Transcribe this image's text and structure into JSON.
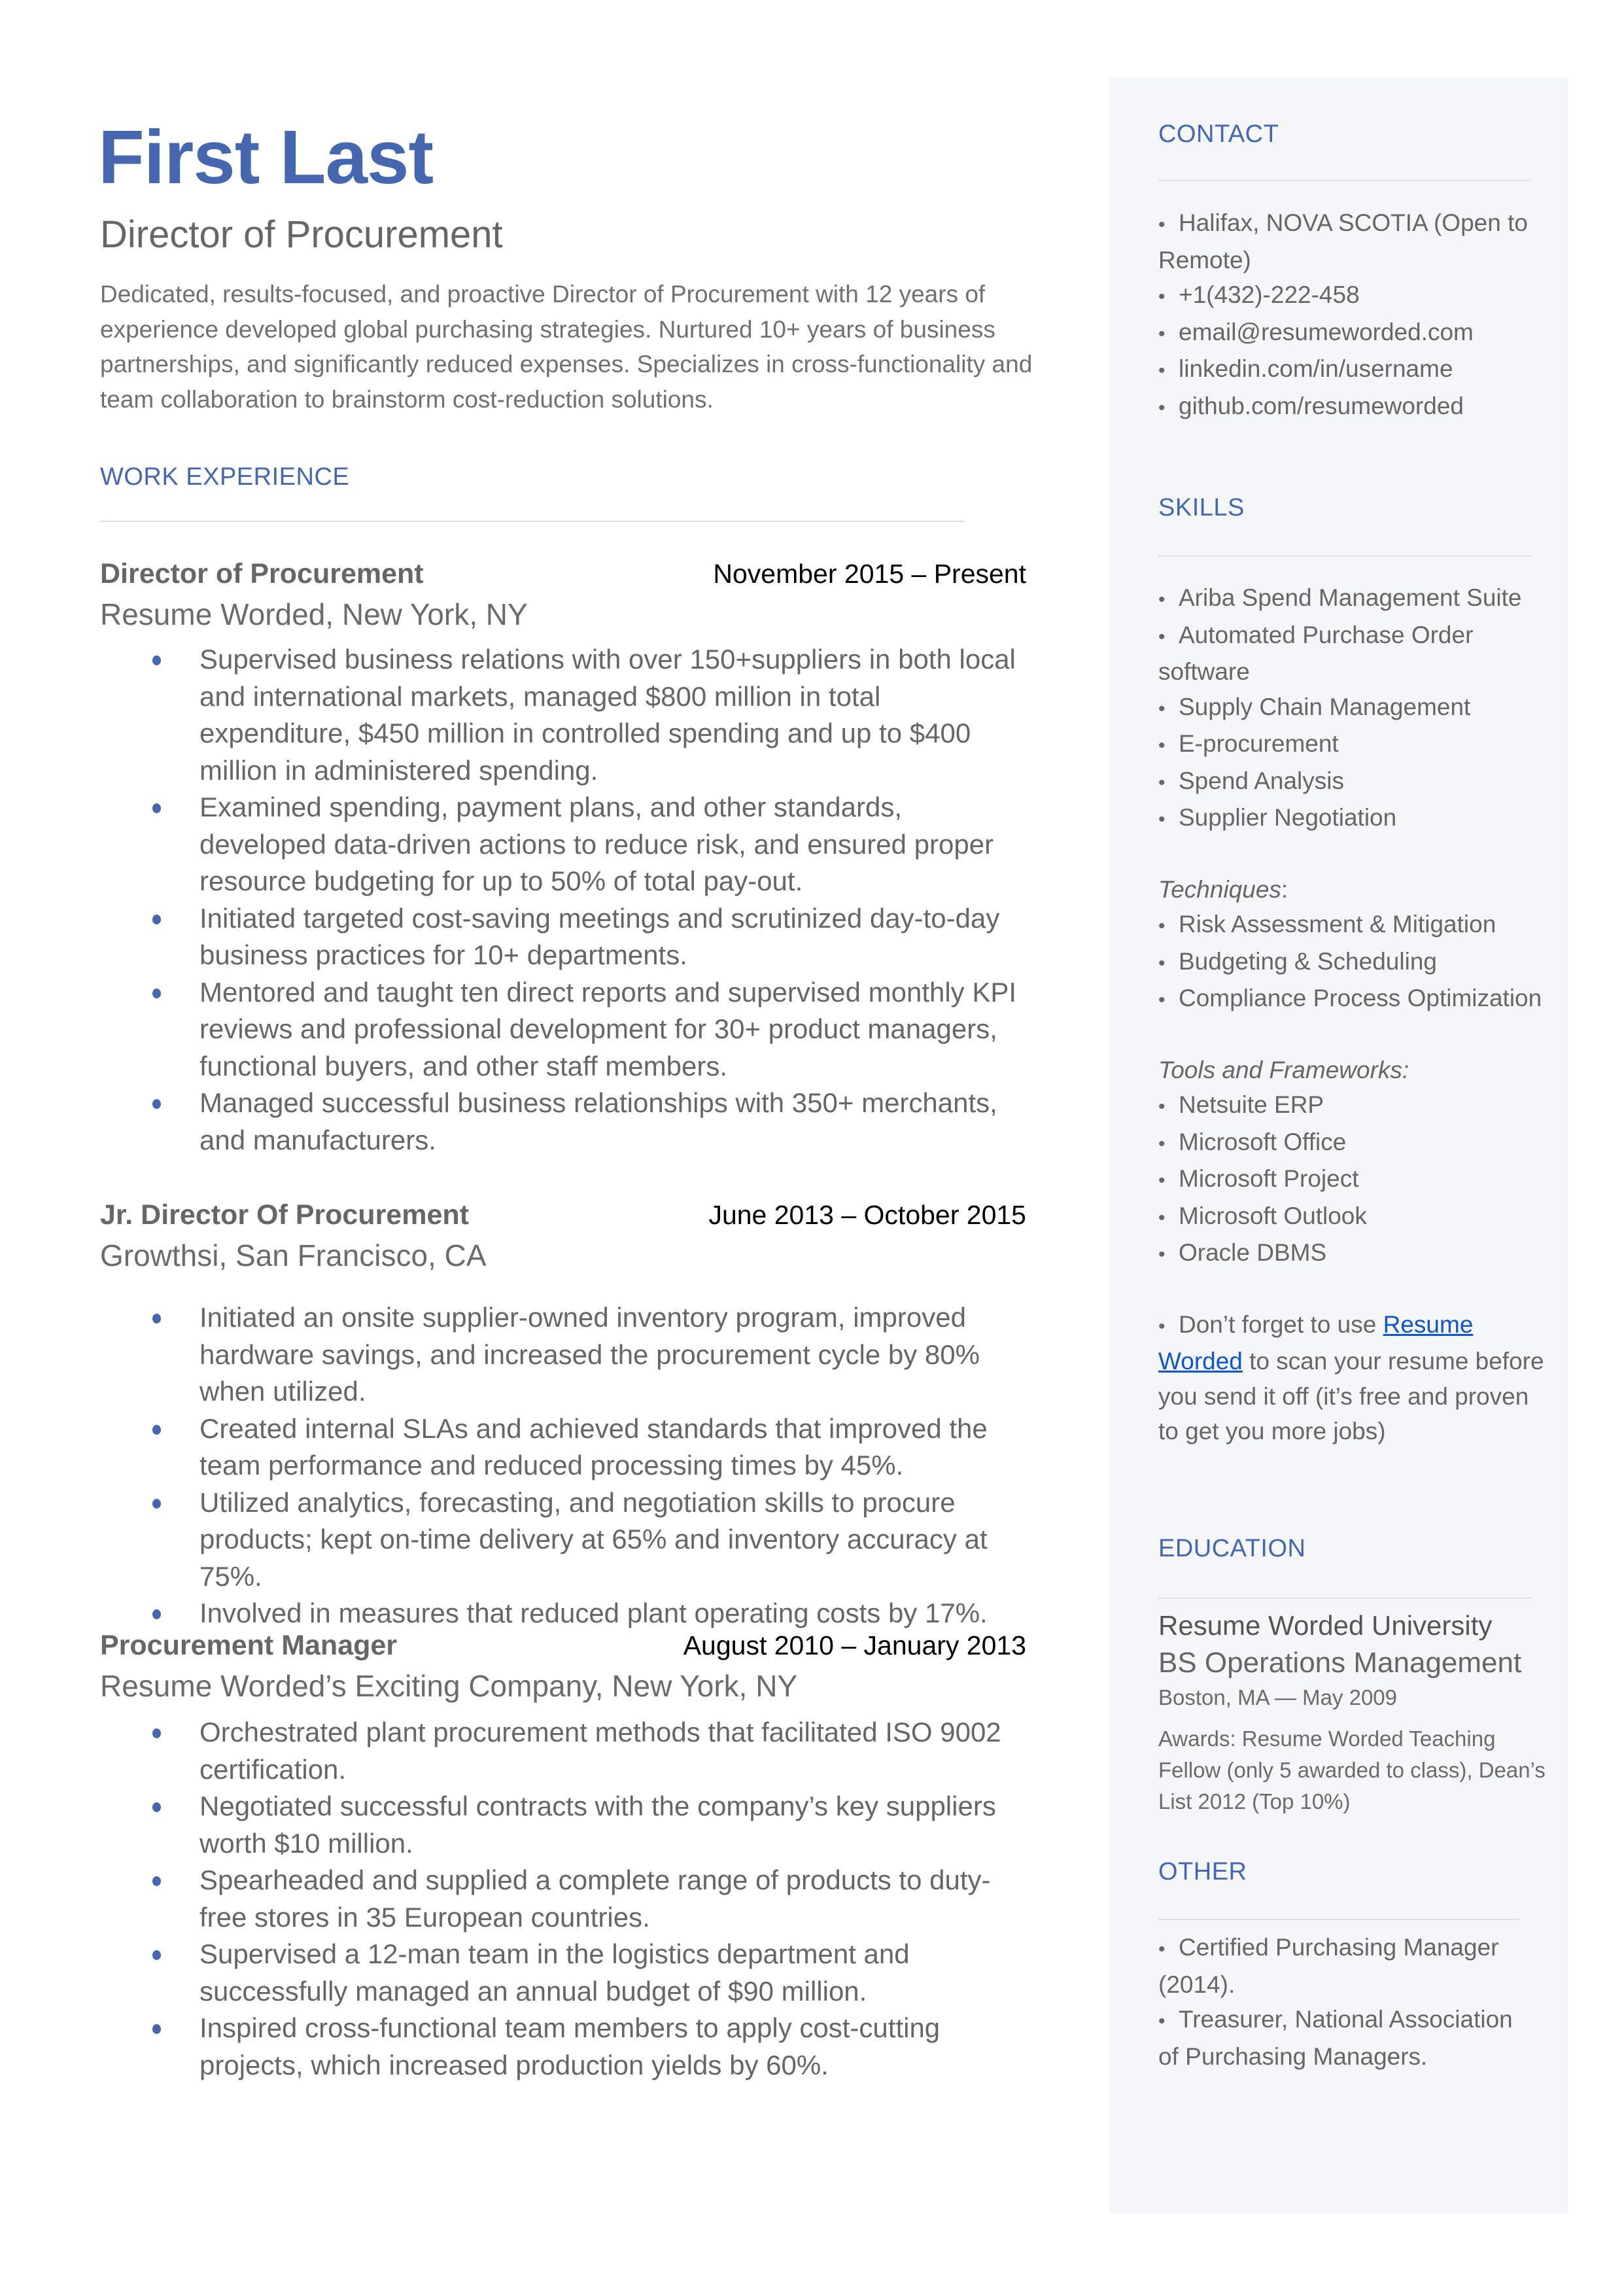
{
  "header": {
    "name": "First Last",
    "title": "Director of Procurement",
    "summary": "Dedicated, results-focused, and proactive Director of Procurement with 12 years of experience developed global purchasing strategies. Nurtured 10+ years of business partnerships, and significantly reduced expenses. Specializes in cross-functionality and team collaboration to brainstorm cost-reduction solutions."
  },
  "colors": {
    "accent": "#4467b0",
    "text": "#666666",
    "sidebar_bg": "#f5f6f8",
    "link": "#1155cc"
  },
  "work": {
    "heading": "WORK EXPERIENCE",
    "jobs": [
      {
        "title": "Director of Procurement",
        "dates": "November 2015 – Present",
        "company": "Resume Worded, New York, NY",
        "bullets": [
          "Supervised business relations with over 150+suppliers in both local and international markets, managed $800 million in total expenditure, $450 million in controlled spending and up to $400 million in administered spending.",
          "Examined spending, payment plans, and other standards, developed data-driven actions to reduce risk, and ensured proper resource budgeting for up to 50% of total pay-out.",
          "Initiated targeted cost-saving meetings and scrutinized day-to-day business practices for 10+ departments.",
          "Mentored and taught ten direct reports and supervised monthly KPI reviews and professional development for 30+ product managers, functional buyers, and other staff members.",
          "Managed successful business relationships with 350+ merchants, and manufacturers."
        ]
      },
      {
        "title": "Jr. Director Of Procurement",
        "dates": "June 2013 – October 2015",
        "company": "Growthsi, San Francisco, CA",
        "bullets": [
          "Initiated an onsite supplier-owned inventory program, improved hardware savings, and increased the procurement cycle by 80% when utilized.",
          "Created internal SLAs and achieved standards that improved the team performance and reduced processing times by 45%.",
          "Utilized analytics, forecasting, and negotiation skills to procure products; kept on-time delivery at 65% and inventory accuracy at 75%.",
          "Involved in measures that reduced plant operating costs by 17%."
        ]
      },
      {
        "title": "Procurement Manager",
        "dates": "August 2010 – January 2013",
        "company": "Resume Worded’s Exciting Company, New York, NY",
        "bullets": [
          "Orchestrated plant procurement methods that facilitated ISO 9002 certification.",
          "Negotiated successful contracts with the company’s key suppliers worth $10 million.",
          "Spearheaded and supplied a complete range of products to duty-free stores in 35 European countries.",
          "Supervised a 12-man team in the logistics department and successfully managed an annual budget of $90 million.",
          "Inspired cross-functional team members to apply cost-cutting projects, which increased production yields by 60%."
        ]
      }
    ]
  },
  "sidebar": {
    "contact": {
      "heading": "CONTACT",
      "items": [
        "Halifax, NOVA SCOTIA (Open to Remote)",
        "+1(432)-222-458",
        "email@resumeworded.com",
        "linkedin.com/in/username",
        "github.com/resumeworded"
      ]
    },
    "skills": {
      "heading": "SKILLS",
      "items": [
        "Ariba Spend Management Suite",
        "Automated Purchase Order software",
        "Supply Chain Management",
        "E-procurement",
        "Spend Analysis",
        "Supplier Negotiation"
      ],
      "techniques_label": "Techniques",
      "techniques_colon": ":",
      "techniques": [
        "Risk Assessment & Mitigation",
        "Budgeting & Scheduling",
        "Compliance Process Optimization"
      ],
      "tools_label": "Tools and Frameworks:",
      "tools": [
        "Netsuite ERP",
        "Microsoft Office",
        "Microsoft Project",
        "Microsoft Outlook",
        "Oracle DBMS"
      ],
      "tip_prefix": "Don’t forget to use ",
      "tip_link": "Resume Worded",
      "tip_suffix": " to scan your resume before you send it off (it’s free and proven to get you more jobs)"
    },
    "education": {
      "heading": "EDUCATION",
      "school": "Resume Worded University",
      "degree": "BS Operations Management",
      "location_date": "Boston, MA — May 2009",
      "awards": "Awards: Resume Worded Teaching Fellow (only 5 awarded to class), Dean’s List 2012 (Top 10%)"
    },
    "other": {
      "heading": "OTHER",
      "items": [
        "Certified Purchasing Manager (2014).",
        "Treasurer, National Association of Purchasing Managers."
      ]
    }
  }
}
